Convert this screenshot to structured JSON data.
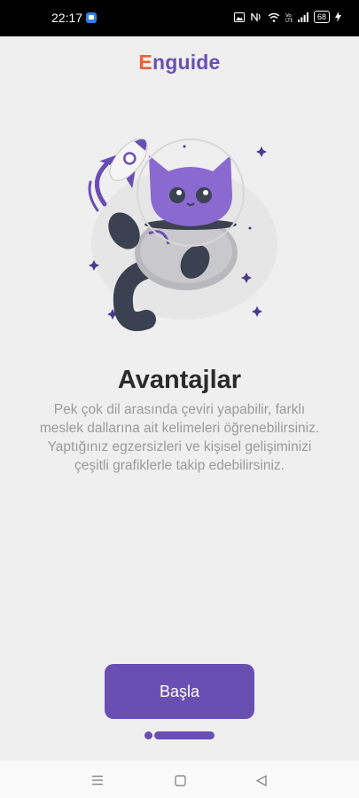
{
  "status_bar": {
    "time": "22:17",
    "battery": "68",
    "icons": [
      "app-notification-icon",
      "image-icon",
      "nfc-icon",
      "wifi-icon",
      "volte-icon",
      "signal-icon",
      "battery-icon",
      "charging-icon"
    ]
  },
  "app": {
    "brand_first": "E",
    "brand_rest": "nguide",
    "brand_color": "#6a4fb3",
    "brand_accent": "#e8623a"
  },
  "onboarding": {
    "title": "Avantajlar",
    "description": "Pek çok dil arasında çeviri yapabilir, farklı meslek dallarına ait kelimeleri öğrenebilirsiniz. Yaptığınız egzersizleri ve kişisel gelişiminizi çeşitli grafiklerle takip edebilirsiniz.",
    "button_label": "Başla",
    "illustration": "astronaut-cat-rocket-illustration"
  },
  "nav": {
    "icons": [
      "menu-icon",
      "home-icon",
      "back-icon"
    ]
  }
}
